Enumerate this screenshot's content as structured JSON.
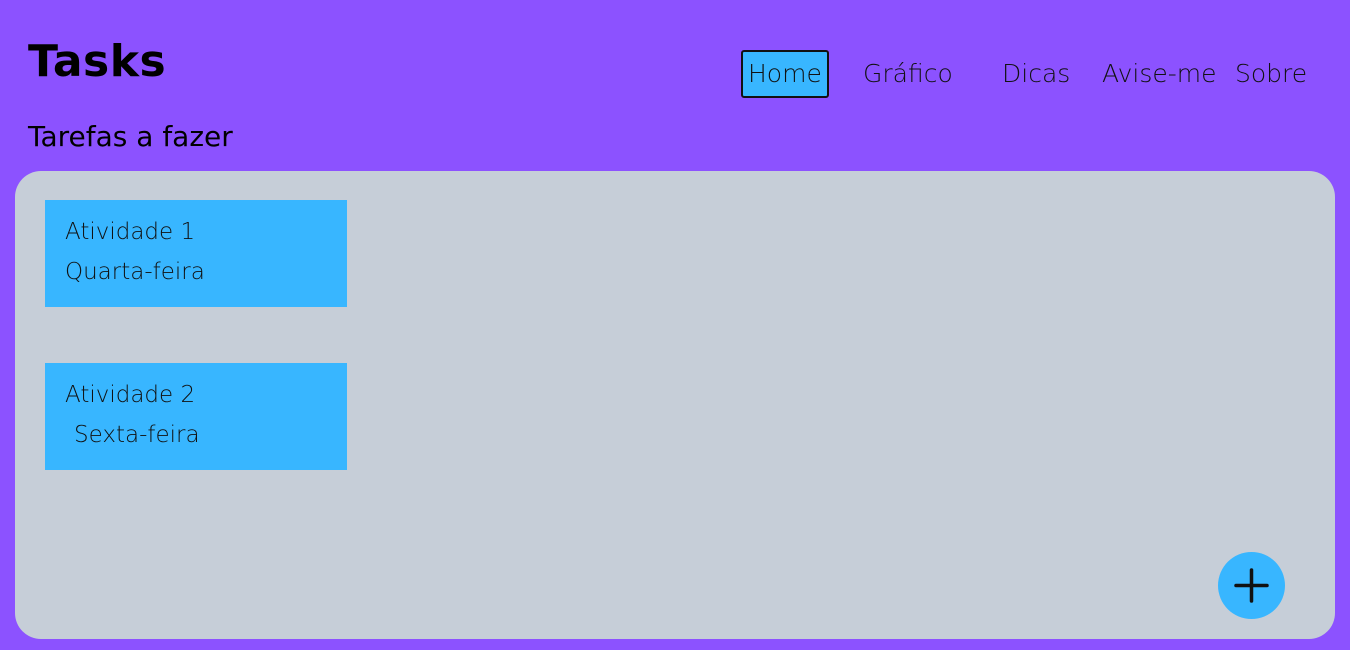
{
  "header": {
    "title": "Tasks",
    "subtitle": "Tarefas a fazer"
  },
  "nav": {
    "items": [
      {
        "label": "Home",
        "active": true
      },
      {
        "label": "Gráfico",
        "active": false
      },
      {
        "label": "Dicas",
        "active": false
      },
      {
        "label": "Avise-me",
        "active": false
      },
      {
        "label": "Sobre",
        "active": false
      }
    ]
  },
  "tasks": [
    {
      "name": "Atividade 1",
      "day": "Quarta-feira"
    },
    {
      "name": "Atividade 2",
      "day": "Sexta-feira"
    }
  ],
  "add_button": {
    "icon": "plus-icon"
  },
  "colors": {
    "background": "#8c52ff",
    "board": "#c6ced8",
    "accent": "#38b6ff",
    "text": "#111111"
  }
}
